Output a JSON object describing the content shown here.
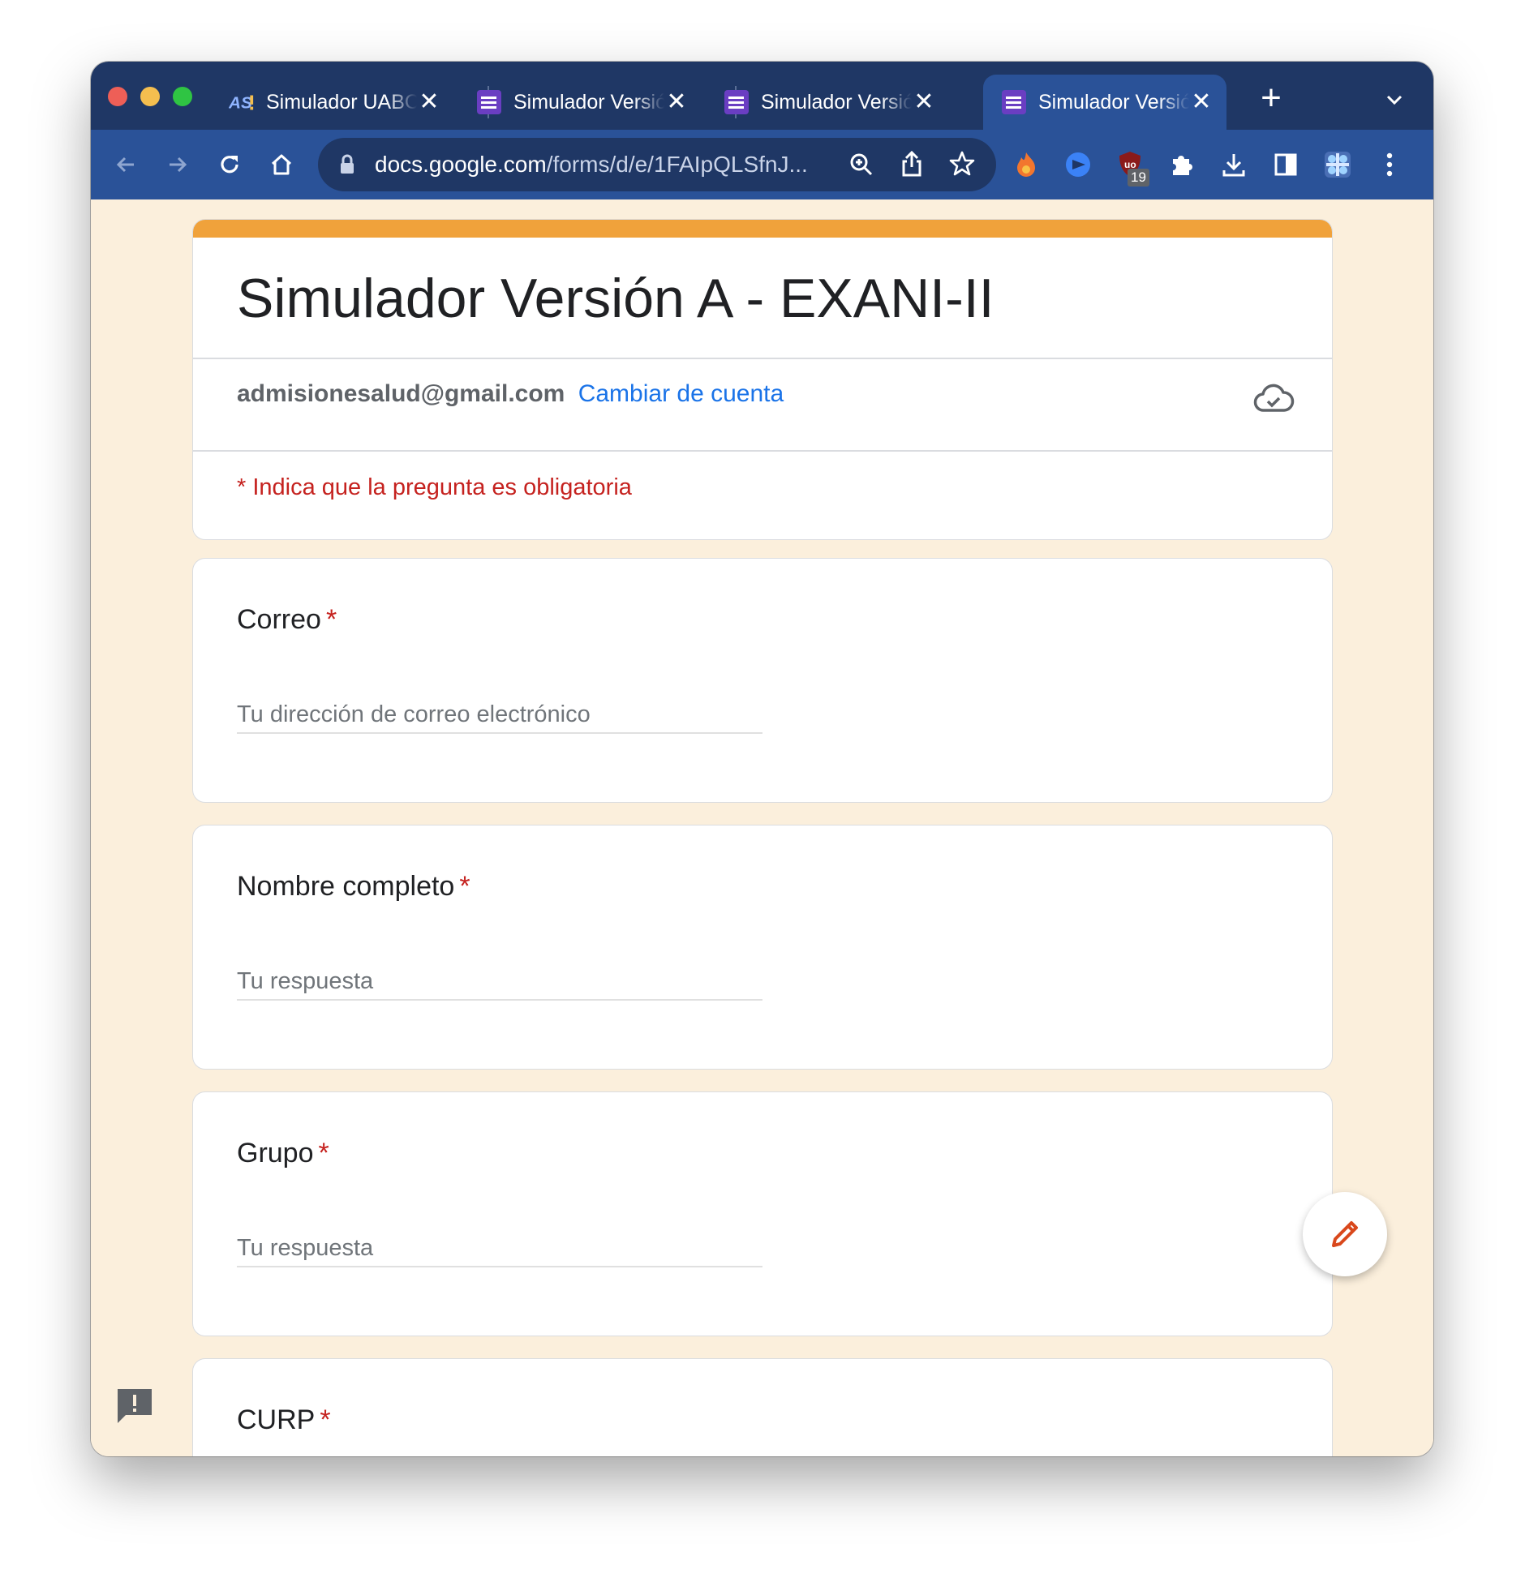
{
  "browser": {
    "tabs": [
      {
        "title": "Simulador UABC",
        "active": false,
        "icon": "asi-icon"
      },
      {
        "title": "Simulador Versión A",
        "active": false,
        "icon": "google-forms-icon"
      },
      {
        "title": "Simulador Versión A",
        "active": false,
        "icon": "google-forms-icon"
      },
      {
        "title": "Simulador Versión A",
        "active": true,
        "icon": "google-forms-icon"
      }
    ],
    "new_tab": "+",
    "close_glyph": "✕",
    "address": {
      "host": "docs.google.com",
      "path": "/forms/d/e/1FAIpQLSfnJ..."
    },
    "extension_badge": "19"
  },
  "form": {
    "title": "Simulador Versión A - EXANI-II",
    "account_email": "admisionesalud@gmail.com",
    "switch_account": "Cambiar de cuenta",
    "required_note": "* Indica que la pregunta es obligatoria",
    "required_mark": "*",
    "questions": [
      {
        "title": "Correo",
        "placeholder": "Tu dirección de correo electrónico"
      },
      {
        "title": "Nombre completo",
        "placeholder": "Tu respuesta"
      },
      {
        "title": "Grupo",
        "placeholder": "Tu respuesta"
      },
      {
        "title": "CURP"
      }
    ]
  },
  "colors": {
    "tab_strip": "#1f3765",
    "toolbar": "#2a5298",
    "page_background": "#fbefdc",
    "header_accent": "#f0a23b",
    "link": "#1a73e8",
    "required": "#c5221f"
  }
}
